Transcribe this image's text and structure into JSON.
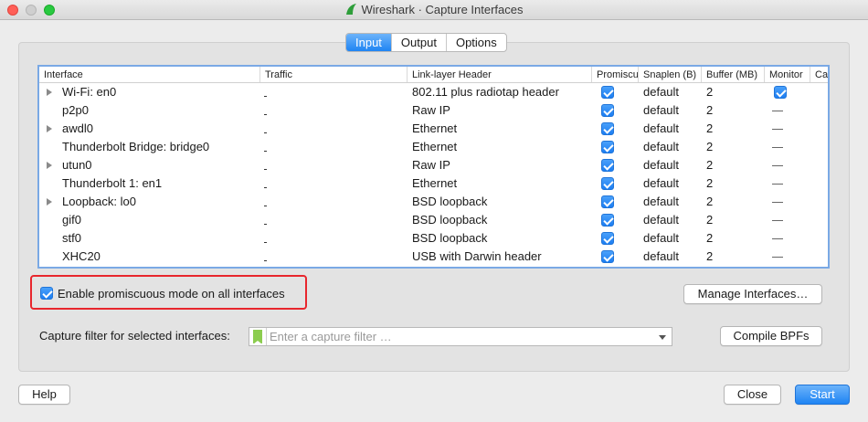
{
  "window": {
    "title": "Wireshark · Capture Interfaces"
  },
  "tabs": [
    {
      "label": "Input",
      "active": true
    },
    {
      "label": "Output",
      "active": false
    },
    {
      "label": "Options",
      "active": false
    }
  ],
  "table": {
    "columns": [
      "Interface",
      "Traffic",
      "Link-layer Header",
      "Promiscuous",
      "Snaplen (B)",
      "Buffer (MB)",
      "Monitor",
      "Ca"
    ],
    "rows": [
      {
        "interface": "Wi-Fi: en0",
        "expandable": true,
        "link": "802.11 plus radiotap header",
        "promiscuous": true,
        "snaplen": "default",
        "buffer": "2",
        "monitor": "checked"
      },
      {
        "interface": "p2p0",
        "expandable": false,
        "link": "Raw IP",
        "promiscuous": true,
        "snaplen": "default",
        "buffer": "2",
        "monitor": "none"
      },
      {
        "interface": "awdl0",
        "expandable": true,
        "link": "Ethernet",
        "promiscuous": true,
        "snaplen": "default",
        "buffer": "2",
        "monitor": "none"
      },
      {
        "interface": "Thunderbolt Bridge: bridge0",
        "expandable": false,
        "link": "Ethernet",
        "promiscuous": true,
        "snaplen": "default",
        "buffer": "2",
        "monitor": "none"
      },
      {
        "interface": "utun0",
        "expandable": true,
        "link": "Raw IP",
        "promiscuous": true,
        "snaplen": "default",
        "buffer": "2",
        "monitor": "none"
      },
      {
        "interface": "Thunderbolt 1: en1",
        "expandable": false,
        "link": "Ethernet",
        "promiscuous": true,
        "snaplen": "default",
        "buffer": "2",
        "monitor": "none"
      },
      {
        "interface": "Loopback: lo0",
        "expandable": true,
        "link": "BSD loopback",
        "promiscuous": true,
        "snaplen": "default",
        "buffer": "2",
        "monitor": "none"
      },
      {
        "interface": "gif0",
        "expandable": false,
        "link": "BSD loopback",
        "promiscuous": true,
        "snaplen": "default",
        "buffer": "2",
        "monitor": "none"
      },
      {
        "interface": "stf0",
        "expandable": false,
        "link": "BSD loopback",
        "promiscuous": true,
        "snaplen": "default",
        "buffer": "2",
        "monitor": "none"
      },
      {
        "interface": "XHC20",
        "expandable": false,
        "link": "USB with Darwin header",
        "promiscuous": true,
        "snaplen": "default",
        "buffer": "2",
        "monitor": "none"
      }
    ]
  },
  "promiscuous_all": {
    "label": "Enable promiscuous mode on all interfaces",
    "checked": true
  },
  "manage_button": "Manage Interfaces…",
  "filter": {
    "label": "Capture filter for selected interfaces:",
    "placeholder": "Enter a capture filter …"
  },
  "compile_button": "Compile BPFs",
  "footer": {
    "help": "Help",
    "close": "Close",
    "start": "Start"
  },
  "colors": {
    "accent": "#1f84f3",
    "highlight": "#e8262d",
    "bookmark": "#8ccd4f"
  }
}
